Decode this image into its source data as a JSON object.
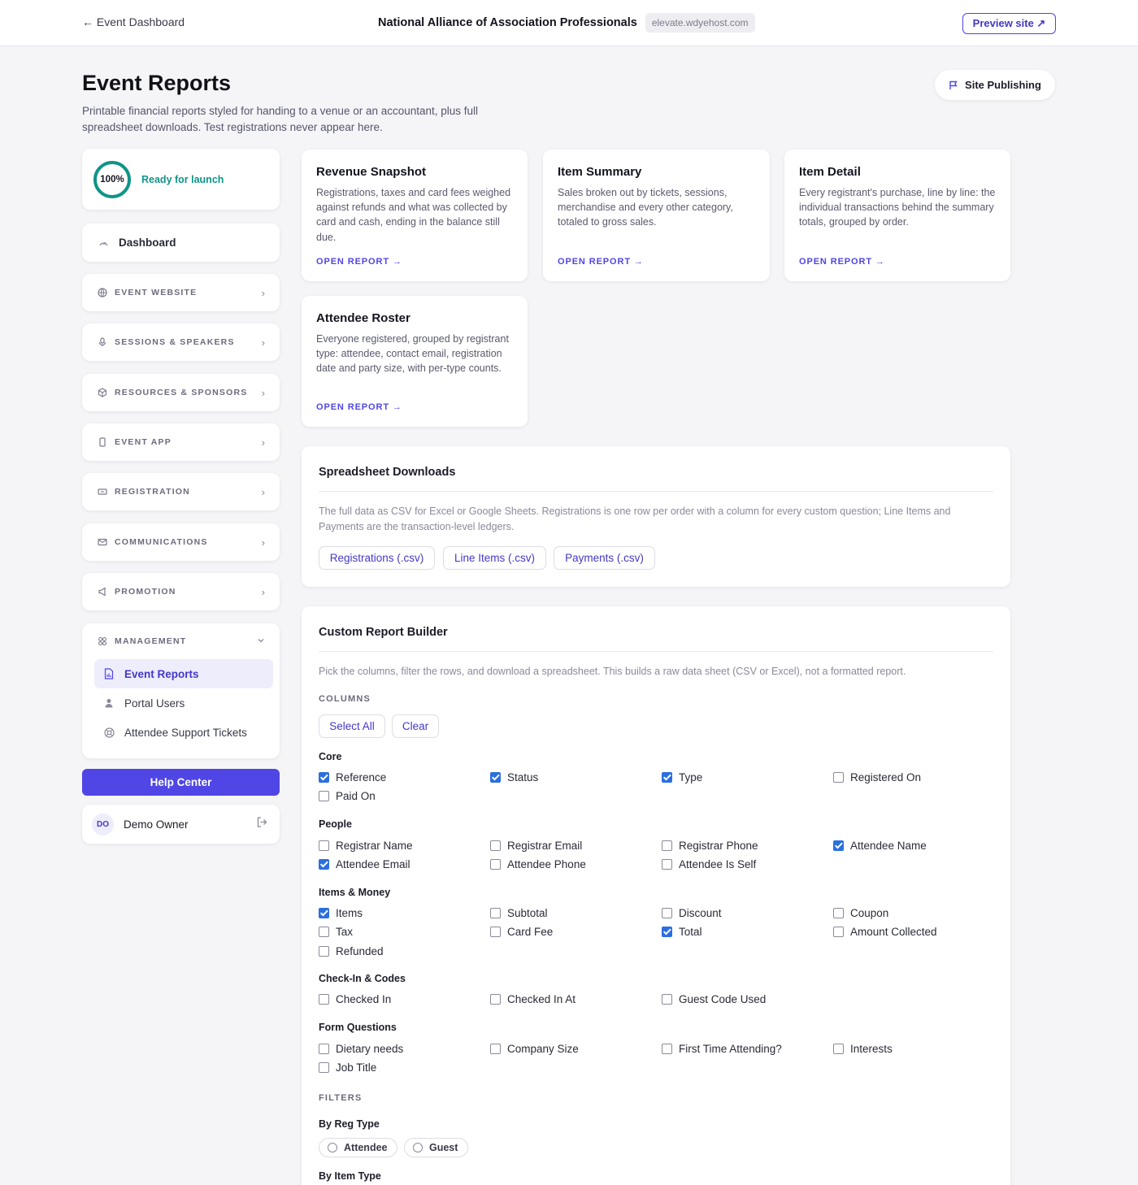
{
  "topbar": {
    "back_label": "← Event Dashboard",
    "org_name": "National Alliance of Association Professionals",
    "domain": "elevate.wdyehost.com",
    "preview_label": "Preview site ↗"
  },
  "header": {
    "title": "Event Reports",
    "description": "Printable financial reports styled for handing to a venue or an accountant, plus full spreadsheet downloads. Test registrations never appear here.",
    "publish_label": "Site Publishing"
  },
  "sidebar": {
    "launch_percent": "100%",
    "launch_label": "Ready for launch",
    "dashboard_label": "Dashboard",
    "sections": [
      {
        "label": "EVENT WEBSITE",
        "icon": "globe-icon"
      },
      {
        "label": "SESSIONS & SPEAKERS",
        "icon": "microphone-icon"
      },
      {
        "label": "RESOURCES & SPONSORS",
        "icon": "box-icon"
      },
      {
        "label": "EVENT APP",
        "icon": "phone-icon"
      },
      {
        "label": "REGISTRATION",
        "icon": "ticket-icon"
      },
      {
        "label": "COMMUNICATIONS",
        "icon": "mail-icon"
      },
      {
        "label": "PROMOTION",
        "icon": "megaphone-icon"
      }
    ],
    "management_label": "MANAGEMENT",
    "management_items": [
      {
        "label": "Event Reports",
        "icon": "report-icon",
        "active": true
      },
      {
        "label": "Portal Users",
        "icon": "user-icon",
        "active": false
      },
      {
        "label": "Attendee Support Tickets",
        "icon": "lifebuoy-icon",
        "active": false
      }
    ],
    "help_label": "Help Center",
    "user": {
      "initials": "DO",
      "name": "Demo Owner"
    }
  },
  "reports": [
    {
      "title": "Revenue Snapshot",
      "description": "Registrations, taxes and card fees weighed against refunds and what was collected by card and cash, ending in the balance still due.",
      "link": "OPEN REPORT →"
    },
    {
      "title": "Item Summary",
      "description": "Sales broken out by tickets, sessions, merchandise and every other category, totaled to gross sales.",
      "link": "OPEN REPORT →"
    },
    {
      "title": "Item Detail",
      "description": "Every registrant's purchase, line by line: the individual transactions behind the summary totals, grouped by order.",
      "link": "OPEN REPORT →"
    },
    {
      "title": "Attendee Roster",
      "description": "Everyone registered, grouped by registrant type: attendee, contact email, registration date and party size, with per-type counts.",
      "link": "OPEN REPORT →"
    }
  ],
  "downloads": {
    "title": "Spreadsheet Downloads",
    "description": "The full data as CSV for Excel or Google Sheets. Registrations is one row per order with a column for every custom question; Line Items and Payments are the transaction-level ledgers.",
    "buttons": [
      "Registrations (.csv)",
      "Line Items (.csv)",
      "Payments (.csv)"
    ]
  },
  "builder": {
    "title": "Custom Report Builder",
    "description": "Pick the columns, filter the rows, and download a spreadsheet. This builds a raw data sheet (CSV or Excel), not a formatted report.",
    "columns_label": "COLUMNS",
    "select_all": "Select All",
    "clear": "Clear",
    "groups": [
      {
        "name": "Core",
        "items": [
          {
            "label": "Reference",
            "checked": true
          },
          {
            "label": "Status",
            "checked": true
          },
          {
            "label": "Type",
            "checked": true
          },
          {
            "label": "Registered On",
            "checked": false
          },
          {
            "label": "Paid On",
            "checked": false
          }
        ]
      },
      {
        "name": "People",
        "items": [
          {
            "label": "Registrar Name",
            "checked": false
          },
          {
            "label": "Registrar Email",
            "checked": false
          },
          {
            "label": "Registrar Phone",
            "checked": false
          },
          {
            "label": "Attendee Name",
            "checked": true
          },
          {
            "label": "Attendee Email",
            "checked": true
          },
          {
            "label": "Attendee Phone",
            "checked": false
          },
          {
            "label": "Attendee Is Self",
            "checked": false
          }
        ]
      },
      {
        "name": "Items & Money",
        "items": [
          {
            "label": "Items",
            "checked": true
          },
          {
            "label": "Subtotal",
            "checked": false
          },
          {
            "label": "Discount",
            "checked": false
          },
          {
            "label": "Coupon",
            "checked": false
          },
          {
            "label": "Tax",
            "checked": false
          },
          {
            "label": "Card Fee",
            "checked": false
          },
          {
            "label": "Total",
            "checked": true
          },
          {
            "label": "Amount Collected",
            "checked": false
          },
          {
            "label": "Refunded",
            "checked": false
          }
        ]
      },
      {
        "name": "Check-In & Codes",
        "items": [
          {
            "label": "Checked In",
            "checked": false
          },
          {
            "label": "Checked In At",
            "checked": false
          },
          {
            "label": "Guest Code Used",
            "checked": false
          }
        ]
      },
      {
        "name": "Form Questions",
        "items": [
          {
            "label": "Dietary needs",
            "checked": false
          },
          {
            "label": "Company Size",
            "checked": false
          },
          {
            "label": "First Time Attending?",
            "checked": false
          },
          {
            "label": "Interests",
            "checked": false
          },
          {
            "label": "Job Title",
            "checked": false
          }
        ]
      }
    ],
    "filters_label": "FILTERS",
    "by_reg_type_label": "By Reg Type",
    "reg_types": [
      "Attendee",
      "Guest"
    ],
    "by_item_type_label": "By Item Type"
  }
}
